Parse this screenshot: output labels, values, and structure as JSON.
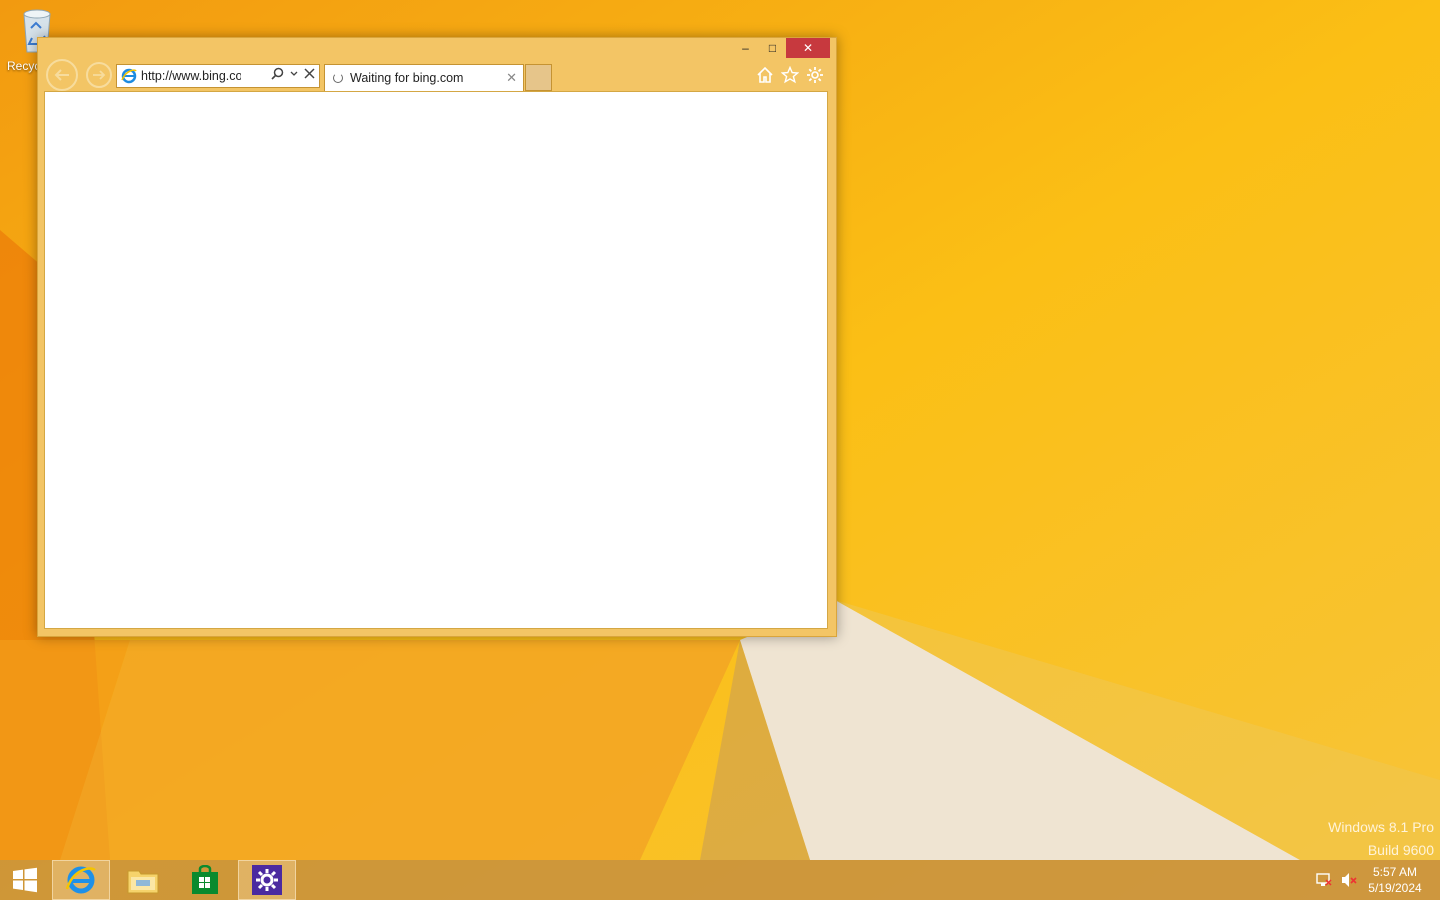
{
  "desktop": {
    "recycle_bin_label": "Recyc",
    "watermark_line1": "Windows 8.1 Pro",
    "watermark_line2": "Build 9600"
  },
  "browser": {
    "address_url": "http://www.bing.com/s",
    "tab_title": "Waiting for bing.com",
    "tab_close": "✕"
  },
  "window_controls": {
    "minimize": "–",
    "maximize": "□",
    "close": "✕"
  },
  "taskbar": {
    "items": [
      "start-button",
      "internet-explorer",
      "file-explorer",
      "store",
      "control-panel"
    ],
    "clock_time": "5:57 AM",
    "clock_date": "5/19/2024"
  },
  "colors": {
    "accent": "#f3c565",
    "close_red": "#c7393e",
    "wallpaper_orange": "#f5b21c"
  }
}
